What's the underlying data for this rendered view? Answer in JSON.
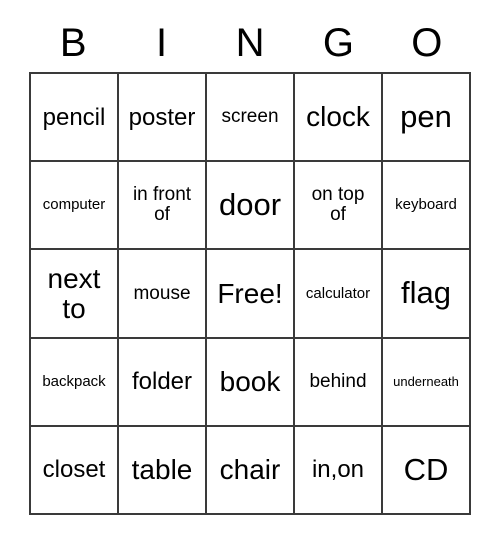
{
  "card": {
    "title": "BINGO",
    "header_letters": [
      "B",
      "I",
      "N",
      "G",
      "O"
    ],
    "border_color": "#3a3a3a",
    "text_color": "#000000",
    "background_color": "#ffffff",
    "columns": 5,
    "rows": 5,
    "free_space": "Free!",
    "cells": [
      [
        {
          "text": "pencil",
          "size": "md"
        },
        {
          "text": "poster",
          "size": "md"
        },
        {
          "text": "screen",
          "size": "sm"
        },
        {
          "text": "clock",
          "size": "lg"
        },
        {
          "text": "pen",
          "size": "xl"
        }
      ],
      [
        {
          "text": "computer",
          "size": "xs"
        },
        {
          "text": "in front\nof",
          "size": "sm"
        },
        {
          "text": "door",
          "size": "xl"
        },
        {
          "text": "on top\nof",
          "size": "sm"
        },
        {
          "text": "keyboard",
          "size": "xs"
        }
      ],
      [
        {
          "text": "next\nto",
          "size": "lg"
        },
        {
          "text": "mouse",
          "size": "sm"
        },
        {
          "text": "Free!",
          "size": "lg"
        },
        {
          "text": "calculator",
          "size": "xs"
        },
        {
          "text": "flag",
          "size": "xl"
        }
      ],
      [
        {
          "text": "backpack",
          "size": "xs"
        },
        {
          "text": "folder",
          "size": "md"
        },
        {
          "text": "book",
          "size": "lg"
        },
        {
          "text": "behind",
          "size": "sm"
        },
        {
          "text": "underneath",
          "size": "xxs"
        }
      ],
      [
        {
          "text": "closet",
          "size": "md"
        },
        {
          "text": "table",
          "size": "lg"
        },
        {
          "text": "chair",
          "size": "lg"
        },
        {
          "text": "in,on",
          "size": "md"
        },
        {
          "text": "CD",
          "size": "xl"
        }
      ]
    ]
  }
}
